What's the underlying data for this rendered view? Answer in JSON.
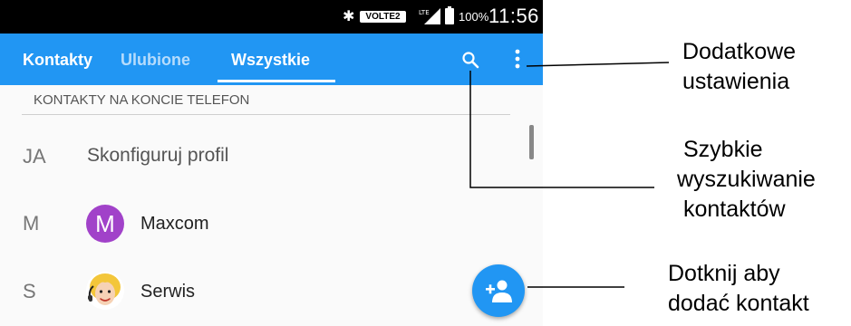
{
  "status_bar": {
    "bluetooth_icon": "bluetooth-icon",
    "volte_label": "VOLTE2",
    "signal_icon": "signal-lte-icon",
    "battery_icon": "battery-icon",
    "battery_percent": "100%",
    "time": "11:56"
  },
  "app_bar": {
    "tabs": [
      {
        "label": "Kontakty"
      },
      {
        "label": "Ulubione"
      },
      {
        "label": "Wszystkie"
      }
    ],
    "active_tab": "Wszystkie",
    "search_icon": "search-icon",
    "more_icon": "more-vert-icon",
    "color": "#2196f3"
  },
  "list": {
    "section_header": "KONTAKTY NA KONCIE TELEFON",
    "profile": {
      "letter": "JA",
      "label": "Skonfiguruj profil"
    },
    "contacts": [
      {
        "letter": "M",
        "avatar_text": "M",
        "name": "Maxcom",
        "avatar_color": "#a142c9"
      },
      {
        "letter": "S",
        "avatar_icon": "cartoon-face-icon",
        "name": "Serwis"
      }
    ]
  },
  "fab": {
    "icon": "add-person-icon"
  },
  "callouts": [
    {
      "line1": "Dodatkowe",
      "line2": "ustawienia"
    },
    {
      "line1": "Szybkie",
      "line2": "wyszukiwanie",
      "line3": "kontaktów"
    },
    {
      "line1": "Dotknij aby",
      "line2": "dodać kontakt"
    }
  ]
}
